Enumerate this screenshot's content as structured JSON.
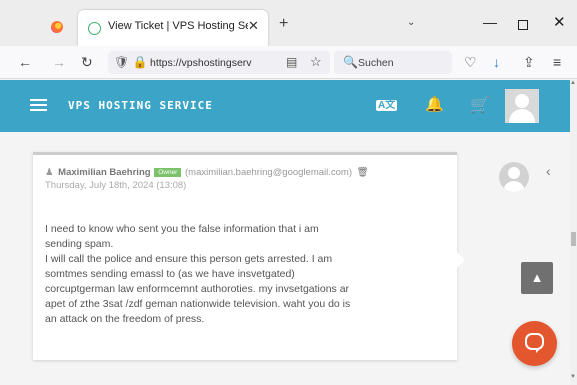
{
  "browser": {
    "tab": {
      "title": "View Ticket | VPS Hosting Servic",
      "close": "✕"
    },
    "new_tab": "+",
    "tab_list": "⌄",
    "window": {
      "minimize": "—",
      "maximize": "",
      "close": "✕"
    },
    "nav": {
      "back": "←",
      "forward": "→",
      "reload": "↻",
      "lock": "🛡 🔒"
    },
    "url": "https://vpshostingserv",
    "search_placeholder": "Suchen",
    "toolbar": {
      "pocket": "♡",
      "downloads": "↓",
      "extensions": "⇪",
      "menu": "≡"
    },
    "reader": "▤",
    "bookmark_star": "☆",
    "search_icon": "🔍"
  },
  "site": {
    "title": "VPS HOSTING SERVICE",
    "lang": "A文",
    "bell": "🔔",
    "cart": "🛒"
  },
  "message": {
    "author": "Maximilian Baehring",
    "badge": "Owner",
    "email": "(maximilian.baehring@googlemail.com)",
    "date": "Thursday, July 18th, 2024 (13:08)",
    "lines": [
      "I need to know who sent you the false information that i am",
      "sending spam.",
      "I will call the police and ensure this person gets arrested. I am",
      "somtmes sending emassl to (as we have insvetgated)",
      "corcuptgerman law enformcemnt authoroties. my invsetgations ar",
      "apet of zthe 3sat /zdf geman nationwide television. waht you do is",
      "an attack on the freedom of press."
    ]
  },
  "side": {
    "chevron": "‹",
    "scroll_top": "▲"
  },
  "scrollbar": {
    "up": "▲",
    "down": "▼"
  }
}
